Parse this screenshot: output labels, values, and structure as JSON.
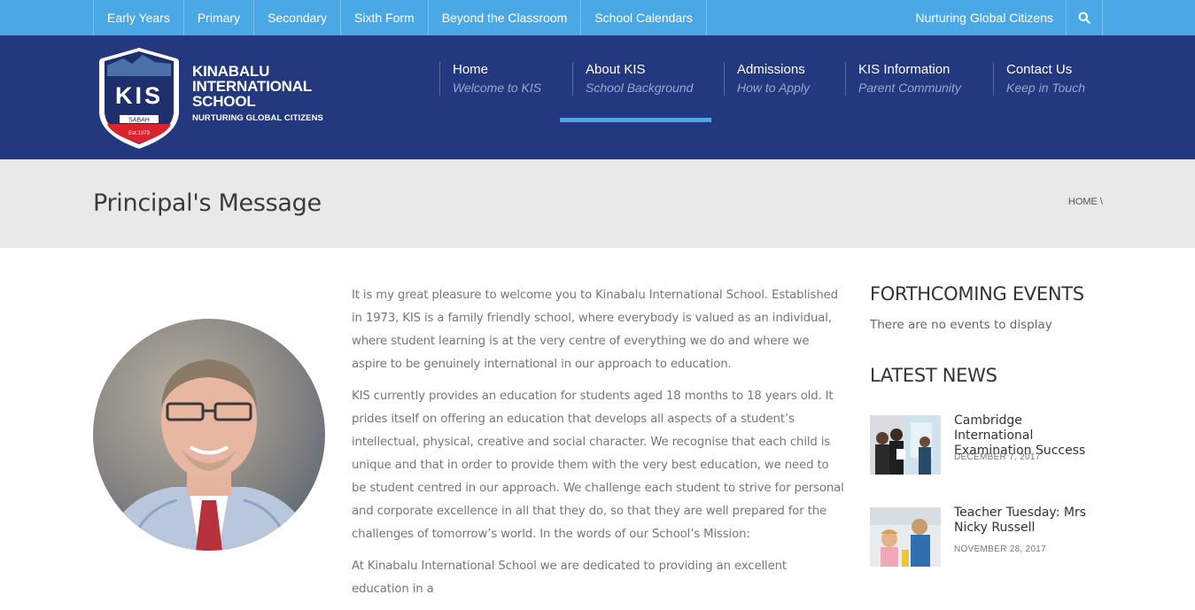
{
  "topbar": {
    "links": [
      "Early Years",
      "Primary",
      "Secondary",
      "Sixth Form",
      "Beyond the Classroom",
      "School Calendars"
    ],
    "slogan": "Nurturing Global Citizens",
    "search_icon": "search-icon"
  },
  "logo": {
    "badge_text": "KIS",
    "ribbon": "SABAH",
    "est": "Est.1973",
    "name_line1": "KINABALU",
    "name_line2": "INTERNATIONAL",
    "name_line3": "SCHOOL",
    "tagline": "NURTURING GLOBAL CITIZENS"
  },
  "mainnav": {
    "items": [
      {
        "title": "Home",
        "subtitle": "Welcome to KIS"
      },
      {
        "title": "About KIS",
        "subtitle": "School Background"
      },
      {
        "title": "Admissions",
        "subtitle": "How to Apply"
      },
      {
        "title": "KIS Information",
        "subtitle": "Parent Community"
      },
      {
        "title": "Contact Us",
        "subtitle": "Keep in Touch"
      }
    ],
    "active": "About KIS"
  },
  "page": {
    "title": "Principal's Message",
    "breadcrumb": "HOME \\"
  },
  "article": {
    "paragraphs": [
      "It is my great pleasure to welcome you to Kinabalu International School. Established in 1973, KIS is a family friendly school, where everybody is valued as an individual, where student learning is at the very centre of everything we do and where we aspire to be genuinely international in our approach to education.",
      "KIS currently provides an education for students aged 18 months to 18 years old. It prides itself on offering an education that develops all aspects of a student’s intellectual, physical, creative and social character. We recognise that each child is unique and that in order to provide them with the very best education, we need to be student centred in our approach. We challenge each student to strive for personal and corporate excellence in all that they do, so that they are well prepared for the challenges of tomorrow’s world. In the words of our School’s Mission:",
      "At Kinabalu International School we are dedicated to providing an excellent education in a"
    ]
  },
  "sidebar": {
    "events_heading": "FORTHCOMING EVENTS",
    "no_events": "There are no events to display",
    "news_heading": "LATEST NEWS",
    "news": [
      {
        "title": "Cambridge International Examination Success",
        "date": "DECEMBER 7, 2017"
      },
      {
        "title": "Teacher Tuesday: Mrs Nicky Russell",
        "date": "NOVEMBER 28, 2017"
      }
    ]
  },
  "colors": {
    "topbar": "#4aa8e5",
    "header": "#24387f",
    "title_band": "#e9e9e9",
    "accent": "#4aa8e5"
  }
}
